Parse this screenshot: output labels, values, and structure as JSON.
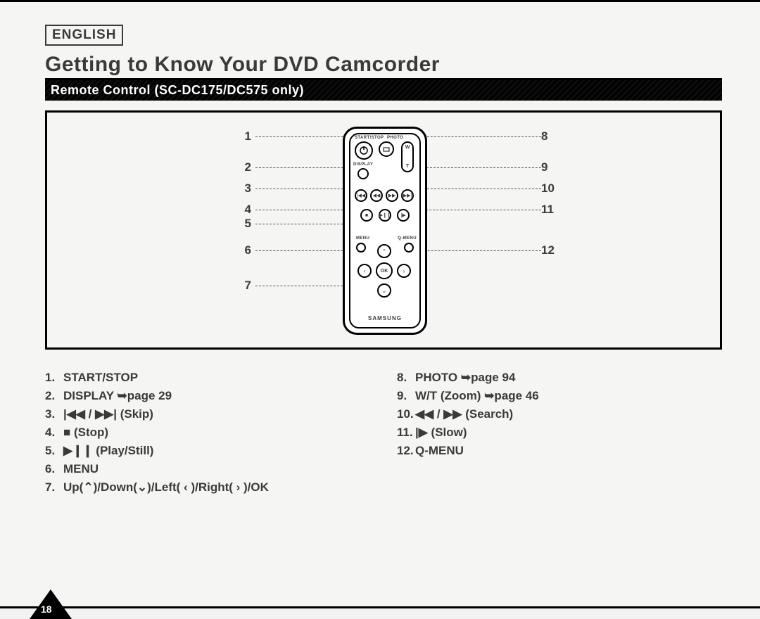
{
  "language_label": "ENGLISH",
  "title": "Getting to Know Your DVD Camcorder",
  "section_bar": "Remote Control (SC-DC175/DC575 only)",
  "page_number": "18",
  "remote_brand": "SAMSUNG",
  "remote_labels": {
    "start_stop": "START/STOP",
    "photo": "PHOTO",
    "display": "DISPLAY",
    "menu": "MENU",
    "qmenu": "Q-MENU",
    "ok": "OK",
    "w": "W",
    "t": "T"
  },
  "callouts": {
    "left": [
      "1",
      "2",
      "3",
      "4",
      "5",
      "6",
      "7"
    ],
    "right": [
      "8",
      "9",
      "10",
      "11",
      "12"
    ]
  },
  "legend": {
    "left": [
      {
        "n": "1.",
        "text": "START/STOP"
      },
      {
        "n": "2.",
        "text": "DISPLAY ➥page 29"
      },
      {
        "n": "3.",
        "text": "|◀◀ / ▶▶| (Skip)"
      },
      {
        "n": "4.",
        "text": "■ (Stop)"
      },
      {
        "n": "5.",
        "text": "▶❙❙ (Play/Still)"
      },
      {
        "n": "6.",
        "text": "MENU"
      },
      {
        "n": "7.",
        "text": "Up(⌃)/Down(⌄)/Left( ‹ )/Right( › )/OK"
      }
    ],
    "right": [
      {
        "n": "8.",
        "text": "PHOTO ➥page 94"
      },
      {
        "n": "9.",
        "text": "W/T (Zoom) ➥page 46"
      },
      {
        "n": "10.",
        "text": "◀◀ / ▶▶ (Search)"
      },
      {
        "n": "11.",
        "text": "|▶ (Slow)"
      },
      {
        "n": "12.",
        "text": "Q-MENU"
      }
    ]
  }
}
